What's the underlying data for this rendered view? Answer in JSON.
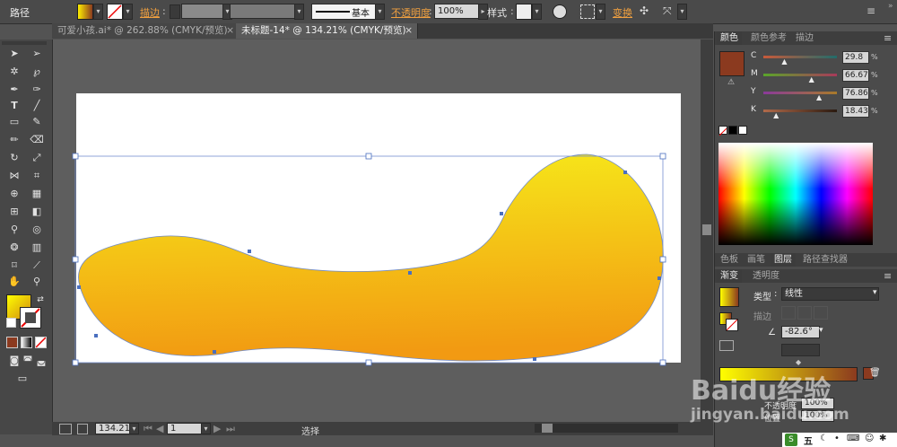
{
  "control_bar": {
    "path_label": "路径",
    "stroke_label": "描边",
    "stroke_style_label": "基本",
    "opacity_label": "不透明度",
    "opacity_value": "100%",
    "style_label": "样式",
    "transform_label": "变换"
  },
  "tabs": [
    {
      "label": "可爱小孩.ai* @ 262.88% (CMYK/预览)",
      "active": false
    },
    {
      "label": "未标题-14* @ 134.21% (CMYK/预览)",
      "active": true
    }
  ],
  "status_bar": {
    "zoom": "134.21",
    "artboard": "1",
    "tool_name": "选择"
  },
  "color_panel": {
    "tabs": [
      "颜色",
      "颜色参考",
      "描边"
    ],
    "active_tab": "颜色",
    "fill_color": "#8b3a1f",
    "channels": [
      {
        "name": "C",
        "value": "29.8",
        "fraction": 0.298
      },
      {
        "name": "M",
        "value": "66.67",
        "fraction": 0.6667
      },
      {
        "name": "Y",
        "value": "76.86",
        "fraction": 0.7686
      },
      {
        "name": "K",
        "value": "18.43",
        "fraction": 0.1843
      }
    ],
    "unit": "%"
  },
  "layers_tabs": [
    "色板",
    "画笔",
    "图层",
    "路径查找器"
  ],
  "layers_active": "图层",
  "gradient_panel": {
    "tabs": [
      "渐变",
      "透明度"
    ],
    "active_tab": "渐变",
    "type_label": "类型",
    "type_value": "线性",
    "stroke_label": "描边",
    "angle_value": "-82.6°",
    "opacity_label": "不透明度",
    "opacity_value": "100%",
    "location_label": "位置",
    "location_value": "100%",
    "gradient_start": "#ffff00",
    "gradient_end": "#8b3a1f"
  },
  "watermark": {
    "brand": "Baidu经验",
    "url": "jingyan.baidu.com"
  },
  "taskbar": {
    "ime": "五"
  },
  "artwork": {
    "gradient_top": "#f6ea1a",
    "gradient_bottom": "#f29a12"
  }
}
